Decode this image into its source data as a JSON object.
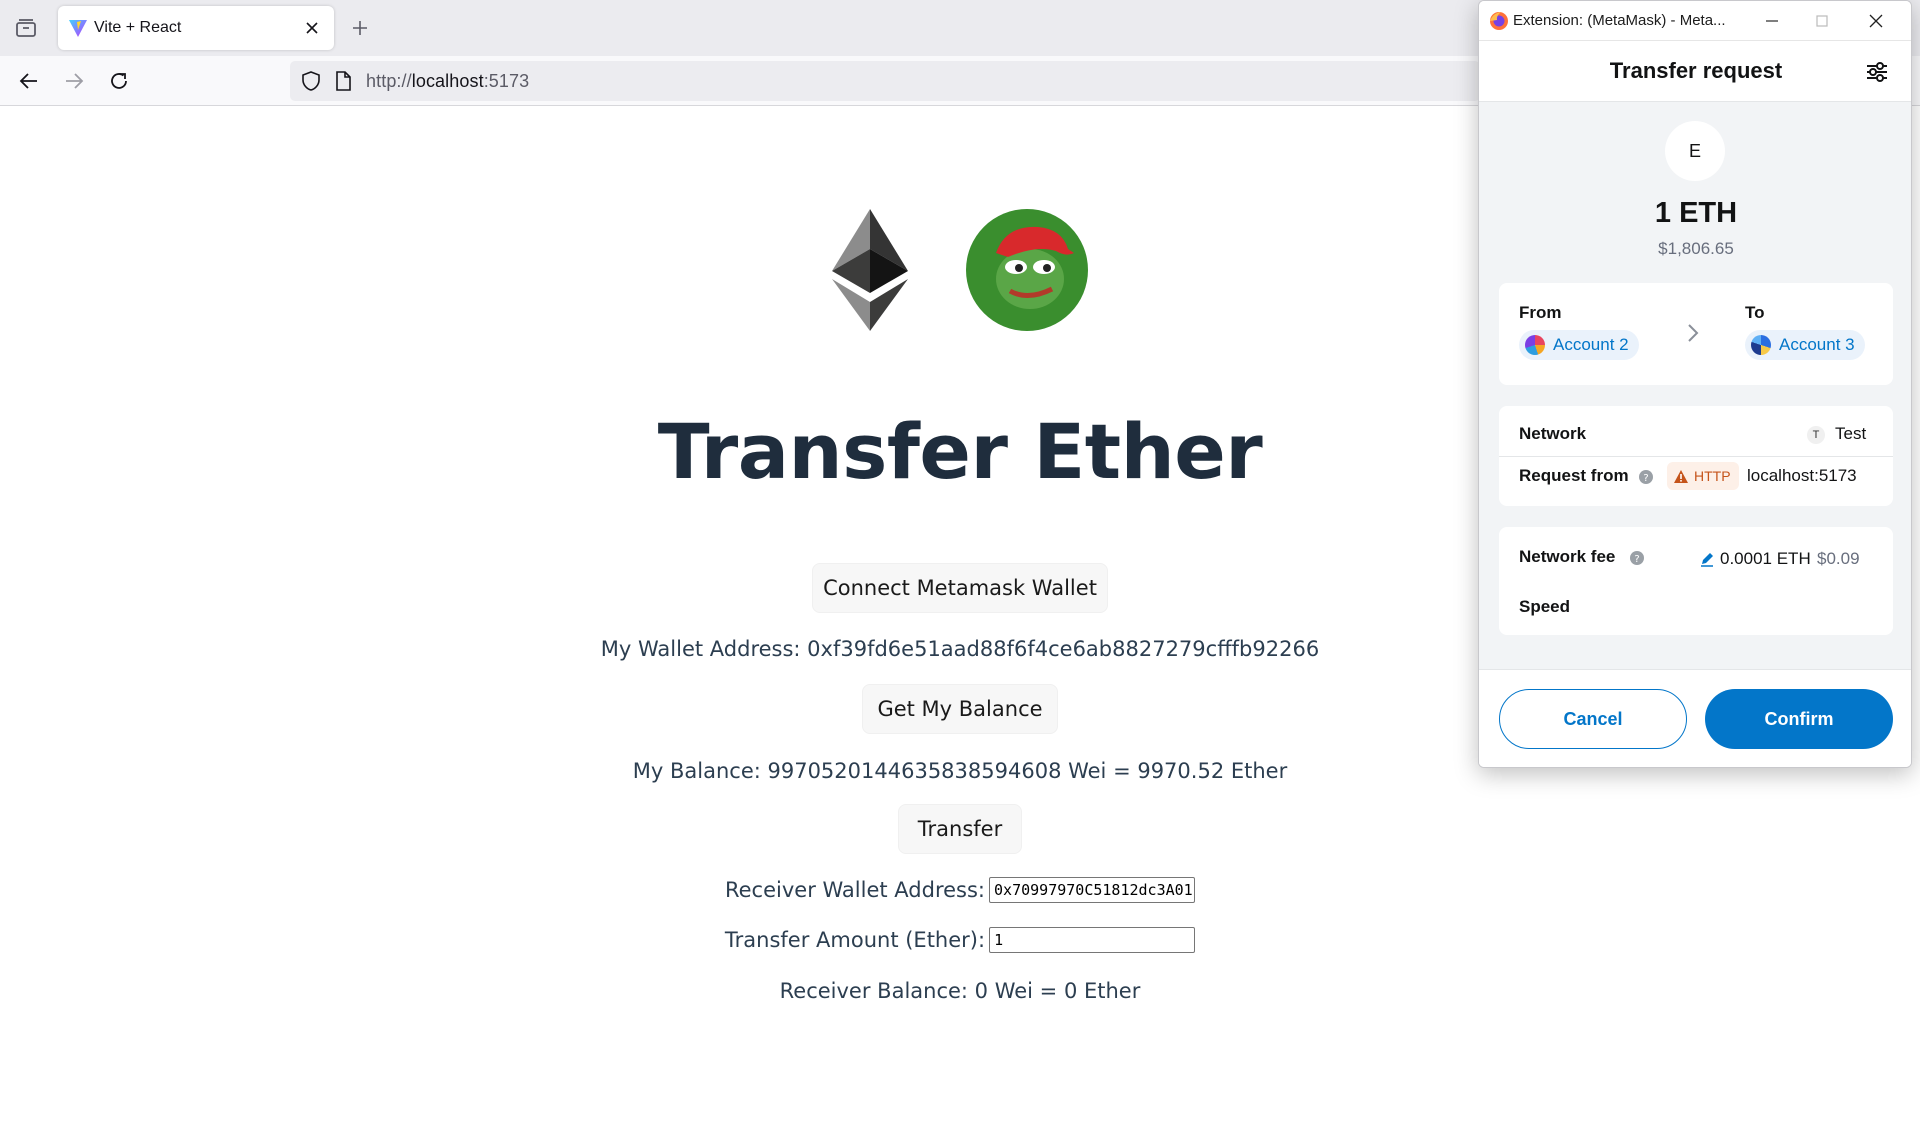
{
  "browser": {
    "tab": {
      "title": "Vite + React"
    },
    "url": {
      "scheme": "http://",
      "host": "localhost",
      "port": ":5173"
    }
  },
  "page": {
    "heading": "Transfer Ether",
    "connect_button": "Connect Metamask Wallet",
    "wallet_address_text": "My Wallet Address: 0xf39fd6e51aad88f6f4ce6ab8827279cfffb92266",
    "get_balance_button": "Get My Balance",
    "balance_text": "My Balance: 9970520144635838594608 Wei = 9970.52 Ether",
    "transfer_button": "Transfer",
    "receiver_label": "Receiver Wallet Address:",
    "receiver_value": "0x70997970C51812dc3A01",
    "amount_label": "Transfer Amount (Ether):",
    "amount_value": "1",
    "receiver_balance_text": "Receiver Balance: 0 Wei = 0 Ether"
  },
  "metamask": {
    "window_title": "Extension: (MetaMask) - Meta...",
    "header_title": "Transfer request",
    "token_letter": "E",
    "amount": "1 ETH",
    "fiat": "$1,806.65",
    "from_label": "From",
    "from_account": "Account 2",
    "to_label": "To",
    "to_account": "Account 3",
    "network_label": "Network",
    "network_letter": "T",
    "network_value": "Test",
    "request_from_label": "Request from",
    "http_badge": "HTTP",
    "request_origin": "localhost:5173",
    "fee_label": "Network fee",
    "fee_eth": "0.0001 ETH",
    "fee_fiat": "$0.09",
    "speed_label": "Speed",
    "cancel_button": "Cancel",
    "confirm_button": "Confirm"
  },
  "colors": {
    "accent_blue": "#0376c9",
    "heading": "#1f2d3d",
    "pepe_green": "#3a8e2e",
    "warning_orange": "#c5541b"
  }
}
